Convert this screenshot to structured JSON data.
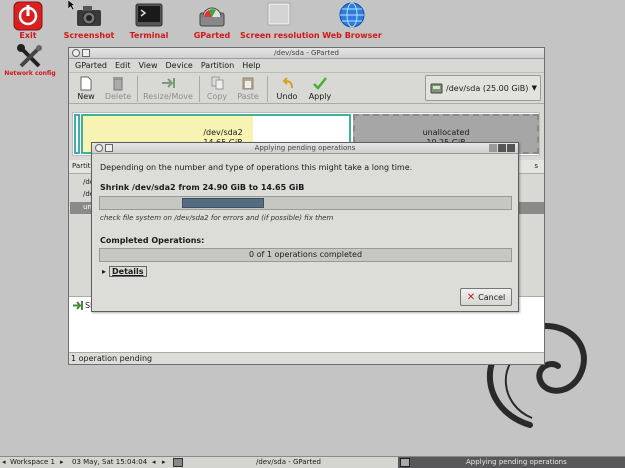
{
  "desktop": {
    "icons": [
      {
        "label": "Exit"
      },
      {
        "label": "Screenshot"
      },
      {
        "label": "Terminal"
      },
      {
        "label": "GParted"
      },
      {
        "label": "Screen resolution"
      },
      {
        "label": "Web Browser"
      },
      {
        "label": "Network config"
      }
    ]
  },
  "window": {
    "title": "/dev/sda - GParted",
    "menu": [
      "GParted",
      "Edit",
      "View",
      "Device",
      "Partition",
      "Help"
    ],
    "toolbar": {
      "new": "New",
      "delete": "Delete",
      "resize": "Resize/Move",
      "copy": "Copy",
      "paste": "Paste",
      "undo": "Undo",
      "apply": "Apply"
    },
    "device_selector": "/dev/sda   (25.00 GiB)",
    "partitions": {
      "sda2_name": "/dev/sda2",
      "sda2_size": "14.65 GiB",
      "unalloc_name": "unallocated",
      "unalloc_size": "10.25 GiB"
    },
    "list": {
      "header": "Partiti",
      "header_right": "s",
      "rows": [
        "/de",
        "/de",
        "un"
      ]
    },
    "ops_pane_prefix": "Sh",
    "status": "1 operation pending"
  },
  "dialog": {
    "title": "Applying pending operations",
    "message": "Depending on the number and type of operations this might take a long time.",
    "current_op": "Shrink /dev/sda2 from 24.90 GiB to 14.65 GiB",
    "current_progress": 0.25,
    "sub_op": "check file system on /dev/sda2 for errors and (if possible) fix them",
    "completed_label": "Completed Operations:",
    "completed_text": "0 of 1 operations completed",
    "details_label": "Details",
    "cancel_label": "Cancel"
  },
  "taskbar": {
    "workspace": "Workspace 1",
    "datetime": "03 May, Sat 15:04:04",
    "task1": "/dev/sda - GParted",
    "task2": "Applying pending operations"
  },
  "colors": {
    "desktop_label": "#d01818",
    "partition_border": "#3eb39a",
    "used_space": "#f7f3b2",
    "unallocated": "#a6a6a6",
    "progress_fill": "#556b80"
  }
}
